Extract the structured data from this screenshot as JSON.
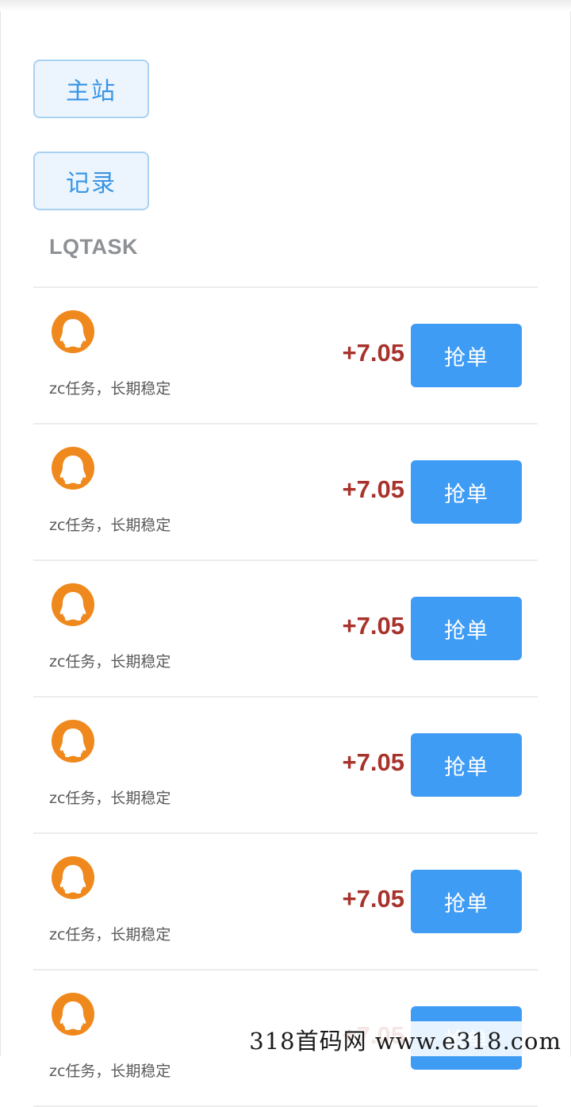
{
  "nav": {
    "main_label": "主站",
    "records_label": "记录"
  },
  "section": {
    "title": "LQTASK"
  },
  "colors": {
    "accent_blue": "#3f9cf5",
    "reward_red": "#a8322c",
    "avatar_orange": "#f0891d"
  },
  "tasks": [
    {
      "icon": "qq-penguin-icon",
      "description": "zc任务，长期稳定",
      "reward": "+7.05",
      "button_label": "抢单"
    },
    {
      "icon": "qq-penguin-icon",
      "description": "zc任务，长期稳定",
      "reward": "+7.05",
      "button_label": "抢单"
    },
    {
      "icon": "qq-penguin-icon",
      "description": "zc任务，长期稳定",
      "reward": "+7.05",
      "button_label": "抢单"
    },
    {
      "icon": "qq-penguin-icon",
      "description": "zc任务，长期稳定",
      "reward": "+7.05",
      "button_label": "抢单"
    },
    {
      "icon": "qq-penguin-icon",
      "description": "zc任务，长期稳定",
      "reward": "+7.05",
      "button_label": "抢单"
    },
    {
      "icon": "qq-penguin-icon",
      "description": "zc任务，长期稳定",
      "reward": "+7.05",
      "button_label": "抢单"
    }
  ],
  "watermark": {
    "text": "318首码网  www.e318.com"
  }
}
